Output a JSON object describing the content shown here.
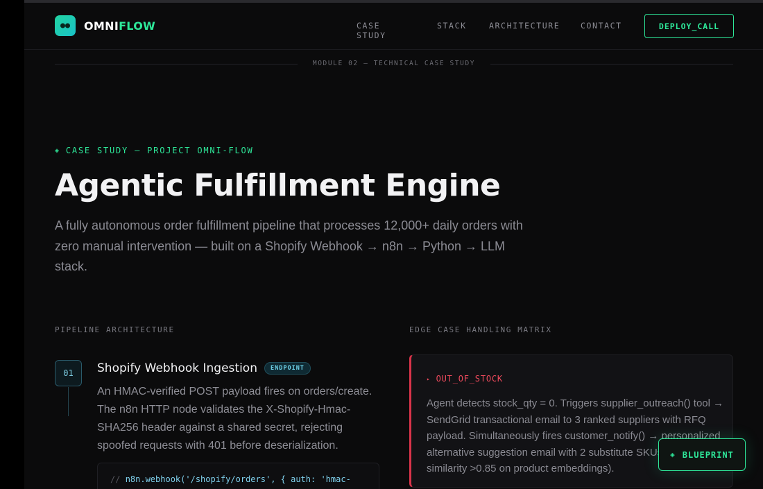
{
  "brand": {
    "name_main": "OMNI",
    "name_accent": "FLOW",
    "accent_color": "#2ee89a"
  },
  "nav": {
    "items": [
      {
        "label": "CASE STUDY"
      },
      {
        "label": "STACK"
      },
      {
        "label": "ARCHITECTURE"
      },
      {
        "label": "CONTACT"
      }
    ],
    "cta_label": "DEPLOY_CALL"
  },
  "module": {
    "label": "MODULE 02 — TECHNICAL CASE STUDY"
  },
  "hero": {
    "eyebrow": "CASE STUDY — PROJECT OMNI-FLOW",
    "eyebrow_icon": "diamond-icon",
    "title": "Agentic Fulfillment Engine",
    "subtitle": "A fully autonomous order fulfillment pipeline that processes 12,000+ daily orders with zero manual intervention — built on a Shopify Webhook → n8n → Python → LLM stack."
  },
  "pipeline": {
    "section_label": "PIPELINE ARCHITECTURE",
    "steps": [
      {
        "number": "01",
        "title": "Shopify Webhook Ingestion",
        "badge": "ENDPOINT",
        "description": "An HMAC-verified POST payload fires on orders/create. The n8n HTTP node validates the X-Shopify-Hmac-SHA256 header against a shared secret, rejecting spoofed requests with 401 before deserialization.",
        "code_comment": "//",
        "code": "n8n.webhook('/shopify/orders', { auth: 'hmac-"
      }
    ]
  },
  "edge_cases": {
    "section_label": "EDGE CASE HANDLING MATRIX",
    "items": [
      {
        "tag": "OUT_OF_STOCK",
        "color": "#ee4a5c",
        "description": "Agent detects stock_qty = 0. Triggers supplier_outreach() tool → SendGrid transactional email to 3 ranked suppliers with RFQ payload. Simultaneously fires customer_notify() → personalized alternative suggestion email with 2 substitute SKUs (cosine similarity >0.85 on product embeddings)."
      }
    ]
  },
  "floating": {
    "blueprint_label": "BLUEPRINT"
  }
}
